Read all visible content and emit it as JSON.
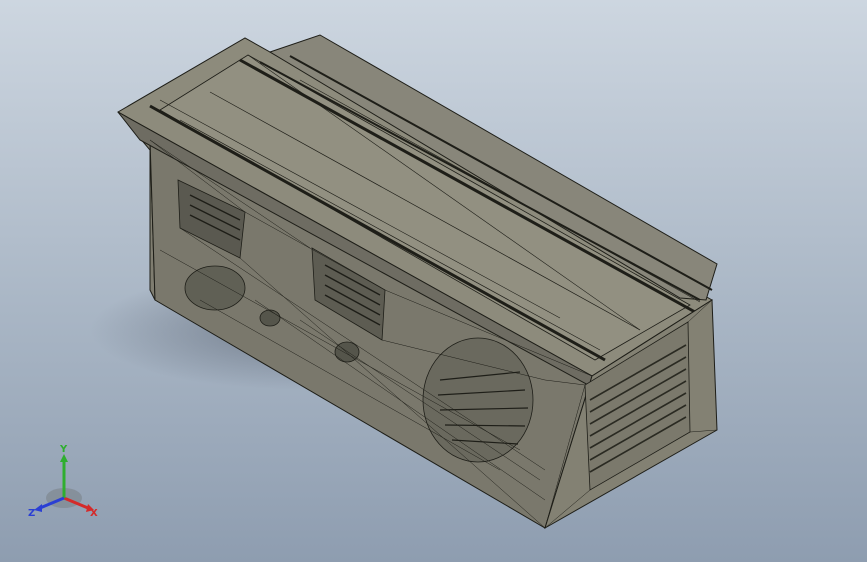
{
  "scene": {
    "background_top": "#cdd6e0",
    "background_bottom": "#8e9db0",
    "model_color": "#8a8878",
    "edge_color": "#1e1e18"
  },
  "triad": {
    "x_label": "X",
    "y_label": "Y",
    "z_label": "Z",
    "x_color": "#d42a2a",
    "y_color": "#2fae2f",
    "z_color": "#2a3fd4"
  }
}
